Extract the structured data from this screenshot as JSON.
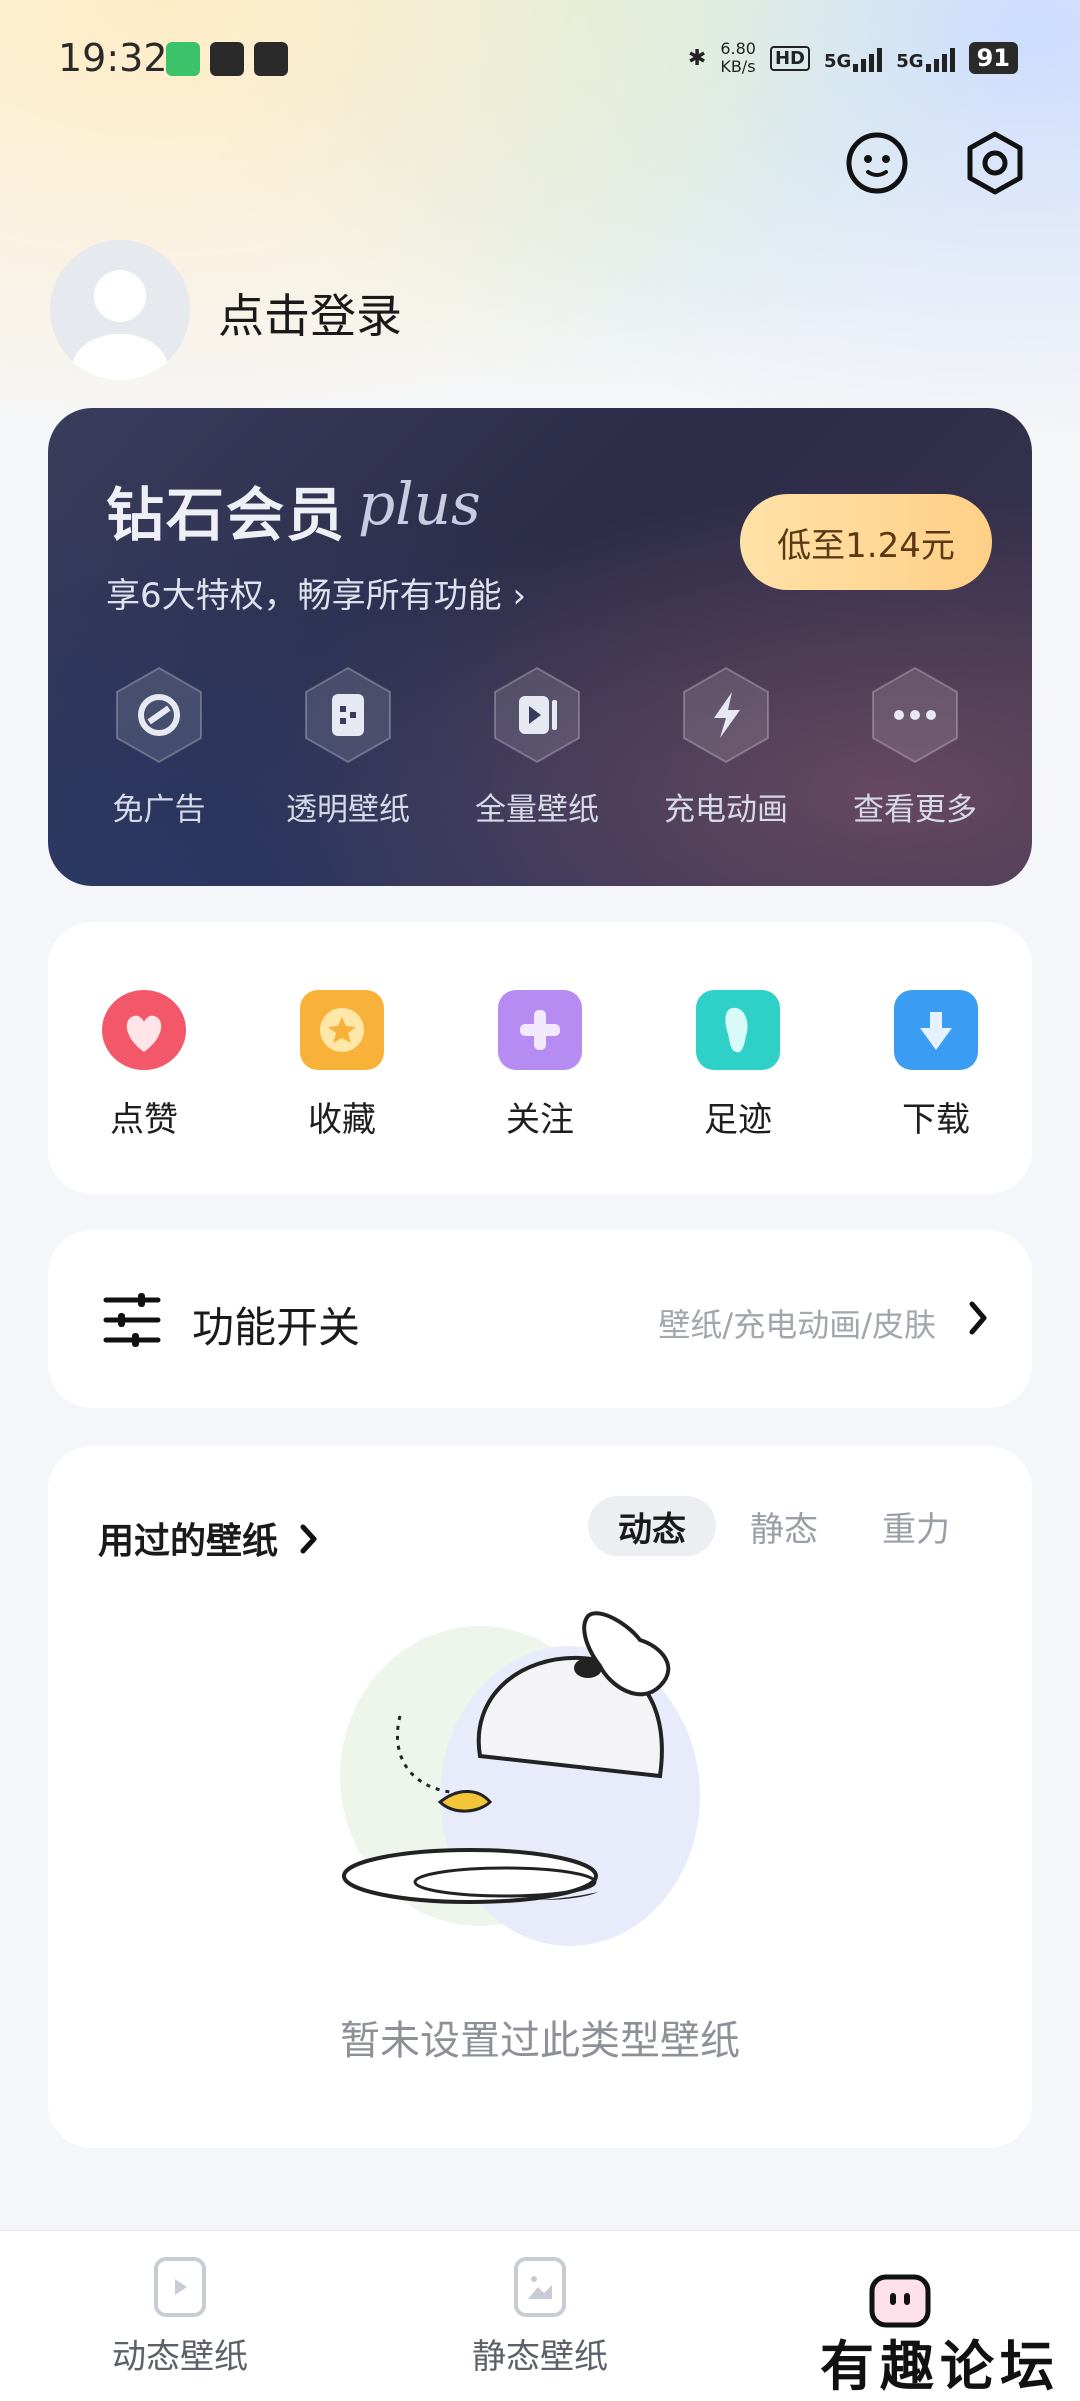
{
  "status_bar": {
    "time": "19:32",
    "net_speed": "6.80",
    "net_unit": "KB/s",
    "hd": "HD",
    "sim1": "5G",
    "sim2": "5G",
    "battery": "91"
  },
  "profile": {
    "login_label": "点击登录"
  },
  "vip": {
    "title": "钻石会员",
    "plus": "plus",
    "subtitle": "享6大特权，畅享所有功能 ›",
    "price_button": "低至1.24元",
    "privileges": [
      {
        "label": "免广告",
        "icon": "no-ads-icon"
      },
      {
        "label": "透明壁纸",
        "icon": "transparent-wallpaper-icon"
      },
      {
        "label": "全量壁纸",
        "icon": "video-wallpaper-icon"
      },
      {
        "label": "充电动画",
        "icon": "lightning-icon"
      },
      {
        "label": "查看更多",
        "icon": "more-dots-icon"
      }
    ]
  },
  "quick_actions": [
    {
      "label": "点赞",
      "icon": "heart-icon",
      "color": "#f2576a"
    },
    {
      "label": "收藏",
      "icon": "star-icon",
      "color": "#f8b23a"
    },
    {
      "label": "关注",
      "icon": "follow-plus-icon",
      "color": "#b68cf2"
    },
    {
      "label": "足迹",
      "icon": "footprint-icon",
      "color": "#2fd0c8"
    },
    {
      "label": "下载",
      "icon": "download-icon",
      "color": "#3a9cf2"
    }
  ],
  "function_switch": {
    "title": "功能开关",
    "subtitle": "壁纸/充电动画/皮肤"
  },
  "used_wallpapers": {
    "title": "用过的壁纸",
    "tabs": [
      "动态",
      "静态",
      "重力"
    ],
    "empty_text": "暂未设置过此类型壁纸"
  },
  "bottom_nav": [
    {
      "label": "动态壁纸"
    },
    {
      "label": "静态壁纸"
    }
  ],
  "watermark": "有趣论坛"
}
